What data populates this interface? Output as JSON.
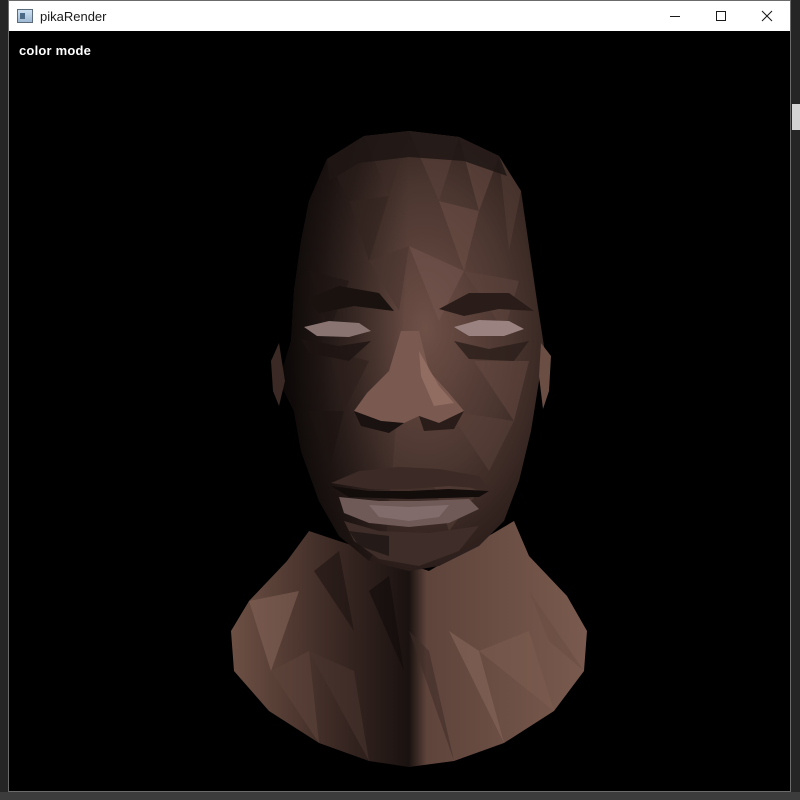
{
  "window": {
    "title": "pikaRender",
    "controls": [
      "minimize",
      "maximize",
      "close"
    ]
  },
  "viewport": {
    "mode_label": "color mode",
    "render": "textured low-poly head model"
  },
  "icons": {
    "app": "app-window-icon",
    "minimize": "minimize-icon",
    "maximize": "maximize-icon",
    "close": "close-icon"
  },
  "colors": {
    "titlebar": "#ffffff",
    "viewport_bg": "#000000",
    "label_text": "#ffffff",
    "skin_shadow": "#2a1d1a",
    "skin_mid": "#5a4038",
    "skin_light": "#7a5a4e"
  }
}
